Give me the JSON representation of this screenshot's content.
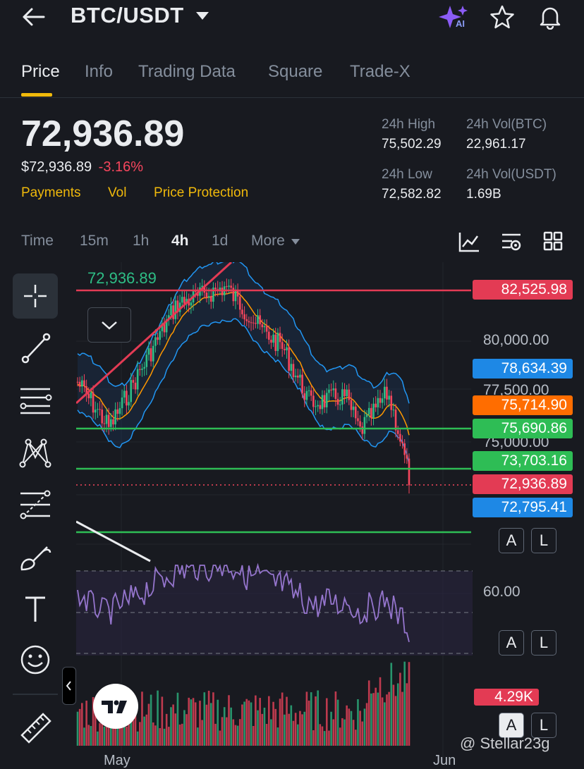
{
  "header": {
    "pair": "BTC/USDT",
    "ai_badge": "AI"
  },
  "tabs": [
    {
      "label": "Price",
      "active": true
    },
    {
      "label": "Info"
    },
    {
      "label": "Trading Data"
    },
    {
      "label": "Square"
    },
    {
      "label": "Trade-X"
    }
  ],
  "price": {
    "last": "72,936.89",
    "fiat": "$72,936.89",
    "change": "-3.16%",
    "links": [
      "Payments",
      "Vol",
      "Price Protection"
    ]
  },
  "stats": {
    "high_label": "24h High",
    "high": "75,502.29",
    "vol_btc_label": "24h Vol(BTC)",
    "vol_btc": "22,961.17",
    "low_label": "24h Low",
    "low": "72,582.82",
    "vol_usdt_label": "24h Vol(USDT)",
    "vol_usdt": "1.69B"
  },
  "timeframes": [
    {
      "label": "Time"
    },
    {
      "label": "15m"
    },
    {
      "label": "1h"
    },
    {
      "label": "4h",
      "active": true
    },
    {
      "label": "1d"
    },
    {
      "label": "More"
    }
  ],
  "chart": {
    "high_marker": "72,936.89",
    "axis": [
      "80,000.00",
      "77,500.00",
      "75,000.00"
    ],
    "tags": [
      {
        "value": "82,525.98",
        "color": "#e33b54"
      },
      {
        "value": "78,634.39",
        "color": "#1e88e5"
      },
      {
        "value": "75,714.90",
        "color": "#ff6d00"
      },
      {
        "value": "75,690.86",
        "color": "#2ebd55"
      },
      {
        "value": "73,703.16",
        "color": "#2ebd55"
      },
      {
        "value": "72,936.89",
        "color": "#e33b54"
      },
      {
        "value": "72,795.41",
        "color": "#1e88e5"
      }
    ],
    "rsi_label": "60.00",
    "volume_label": "4.29K",
    "x_labels": [
      "May",
      "Jun"
    ],
    "btn_a": "A",
    "btn_l": "L"
  },
  "watermark": "@ Stellar23g",
  "colors": {
    "bg": "#181a20",
    "accent": "#f0b90b",
    "down": "#f6465d",
    "up": "#2ebd85"
  }
}
